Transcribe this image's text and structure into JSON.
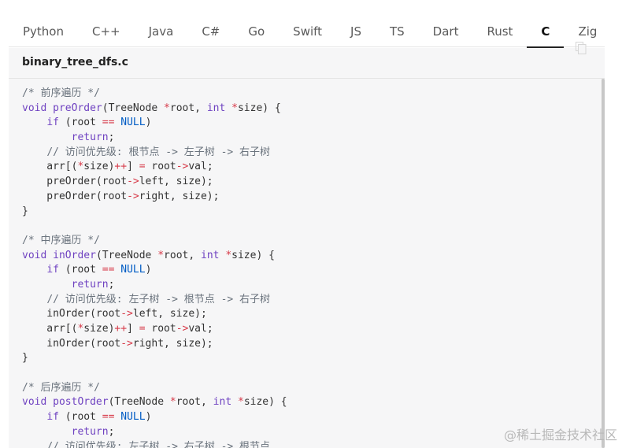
{
  "tabs": [
    {
      "label": "Python",
      "active": false
    },
    {
      "label": "C++",
      "active": false
    },
    {
      "label": "Java",
      "active": false
    },
    {
      "label": "C#",
      "active": false
    },
    {
      "label": "Go",
      "active": false
    },
    {
      "label": "Swift",
      "active": false
    },
    {
      "label": "JS",
      "active": false
    },
    {
      "label": "TS",
      "active": false
    },
    {
      "label": "Dart",
      "active": false
    },
    {
      "label": "Rust",
      "active": false
    },
    {
      "label": "C",
      "active": true
    },
    {
      "label": "Zig",
      "active": false
    }
  ],
  "file": {
    "name": "binary_tree_dfs.c"
  },
  "code_lines": [
    [
      [
        "cm",
        "/* 前序遍历 */"
      ]
    ],
    [
      [
        "kw",
        "void"
      ],
      [
        "",
        " "
      ],
      [
        "fn",
        "preOrder"
      ],
      [
        "",
        "(TreeNode "
      ],
      [
        "op",
        "*"
      ],
      [
        "",
        "root, "
      ],
      [
        "kw",
        "int"
      ],
      [
        "",
        " "
      ],
      [
        "op",
        "*"
      ],
      [
        "",
        "size) {"
      ]
    ],
    [
      [
        "",
        "    "
      ],
      [
        "kw",
        "if"
      ],
      [
        "",
        " (root "
      ],
      [
        "op",
        "=="
      ],
      [
        "",
        " "
      ],
      [
        "cn",
        "NULL"
      ],
      [
        "",
        ")"
      ]
    ],
    [
      [
        "",
        "        "
      ],
      [
        "kw",
        "return"
      ],
      [
        "",
        ";"
      ]
    ],
    [
      [
        "",
        "    "
      ],
      [
        "cm",
        "// 访问优先级: 根节点 -> 左子树 -> 右子树"
      ]
    ],
    [
      [
        "",
        "    arr[("
      ],
      [
        "op",
        "*"
      ],
      [
        "",
        "size)"
      ],
      [
        "op",
        "++"
      ],
      [
        "",
        "] "
      ],
      [
        "op",
        "="
      ],
      [
        "",
        " root"
      ],
      [
        "op",
        "->"
      ],
      [
        "",
        "val;"
      ]
    ],
    [
      [
        "",
        "    preOrder(root"
      ],
      [
        "op",
        "->"
      ],
      [
        "",
        "left, size);"
      ]
    ],
    [
      [
        "",
        "    preOrder(root"
      ],
      [
        "op",
        "->"
      ],
      [
        "",
        "right, size);"
      ]
    ],
    [
      [
        "",
        "}"
      ]
    ],
    [
      [
        "",
        ""
      ]
    ],
    [
      [
        "cm",
        "/* 中序遍历 */"
      ]
    ],
    [
      [
        "kw",
        "void"
      ],
      [
        "",
        " "
      ],
      [
        "fn",
        "inOrder"
      ],
      [
        "",
        "(TreeNode "
      ],
      [
        "op",
        "*"
      ],
      [
        "",
        "root, "
      ],
      [
        "kw",
        "int"
      ],
      [
        "",
        " "
      ],
      [
        "op",
        "*"
      ],
      [
        "",
        "size) {"
      ]
    ],
    [
      [
        "",
        "    "
      ],
      [
        "kw",
        "if"
      ],
      [
        "",
        " (root "
      ],
      [
        "op",
        "=="
      ],
      [
        "",
        " "
      ],
      [
        "cn",
        "NULL"
      ],
      [
        "",
        ")"
      ]
    ],
    [
      [
        "",
        "        "
      ],
      [
        "kw",
        "return"
      ],
      [
        "",
        ";"
      ]
    ],
    [
      [
        "",
        "    "
      ],
      [
        "cm",
        "// 访问优先级: 左子树 -> 根节点 -> 右子树"
      ]
    ],
    [
      [
        "",
        "    inOrder(root"
      ],
      [
        "op",
        "->"
      ],
      [
        "",
        "left, size);"
      ]
    ],
    [
      [
        "",
        "    arr[("
      ],
      [
        "op",
        "*"
      ],
      [
        "",
        "size)"
      ],
      [
        "op",
        "++"
      ],
      [
        "",
        "] "
      ],
      [
        "op",
        "="
      ],
      [
        "",
        " root"
      ],
      [
        "op",
        "->"
      ],
      [
        "",
        "val;"
      ]
    ],
    [
      [
        "",
        "    inOrder(root"
      ],
      [
        "op",
        "->"
      ],
      [
        "",
        "right, size);"
      ]
    ],
    [
      [
        "",
        "}"
      ]
    ],
    [
      [
        "",
        ""
      ]
    ],
    [
      [
        "cm",
        "/* 后序遍历 */"
      ]
    ],
    [
      [
        "kw",
        "void"
      ],
      [
        "",
        " "
      ],
      [
        "fn",
        "postOrder"
      ],
      [
        "",
        "(TreeNode "
      ],
      [
        "op",
        "*"
      ],
      [
        "",
        "root, "
      ],
      [
        "kw",
        "int"
      ],
      [
        "",
        " "
      ],
      [
        "op",
        "*"
      ],
      [
        "",
        "size) {"
      ]
    ],
    [
      [
        "",
        "    "
      ],
      [
        "kw",
        "if"
      ],
      [
        "",
        " (root "
      ],
      [
        "op",
        "=="
      ],
      [
        "",
        " "
      ],
      [
        "cn",
        "NULL"
      ],
      [
        "",
        ")"
      ]
    ],
    [
      [
        "",
        "        "
      ],
      [
        "kw",
        "return"
      ],
      [
        "",
        ";"
      ]
    ],
    [
      [
        "",
        "    "
      ],
      [
        "cm",
        "// 访问优先级: 左子树 -> 右子树 -> 根节点"
      ]
    ]
  ],
  "icons": {
    "copy": "copy-icon"
  },
  "colors": {
    "panel_bg": "#f6f6f7",
    "keyword": "#6f42c1",
    "operator": "#d73a49",
    "constant": "#005cc5",
    "comment": "#6a737d",
    "active_tab_underline": "#222222"
  },
  "watermark": "@稀土掘金技术社区"
}
